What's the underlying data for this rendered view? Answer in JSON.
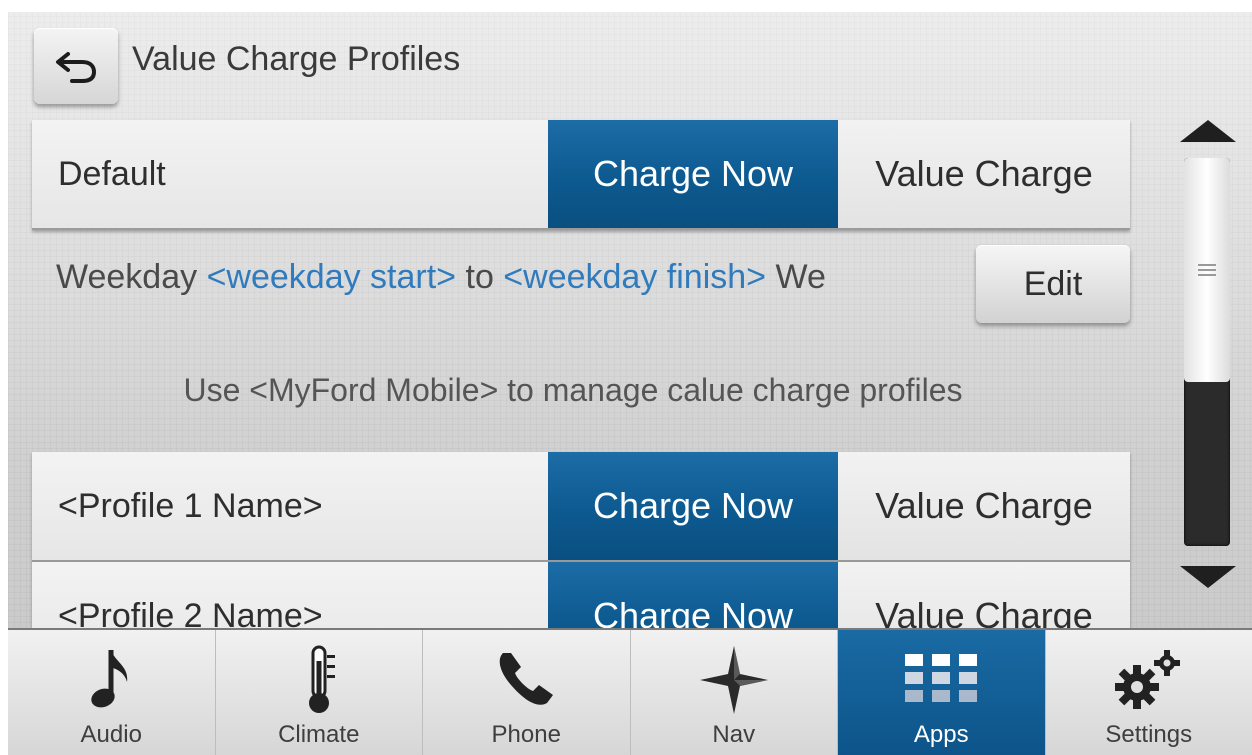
{
  "header": {
    "title": "Value Charge Profiles",
    "back_icon": "back-arrow-icon"
  },
  "rows": [
    {
      "name": "Default",
      "charge_now": "Charge Now",
      "value_charge": "Value Charge",
      "selected": "Charge Now"
    },
    {
      "name": "<Profile 1 Name>",
      "charge_now": "Charge Now",
      "value_charge": "Value Charge",
      "selected": "Charge Now"
    },
    {
      "name": "<Profile 2 Name>",
      "charge_now": "Charge Now",
      "value_charge": "Value Charge",
      "selected": "Charge Now"
    }
  ],
  "schedule": {
    "prefix": "Weekday ",
    "start": "<weekday start>",
    "mid": " to ",
    "finish": "<weekday finish>",
    "suffix": " We"
  },
  "edit_label": "Edit",
  "manage_note": "Use <MyFord Mobile> to manage calue charge profiles",
  "nav": {
    "active": "Apps",
    "tabs": [
      {
        "label": "Audio",
        "icon": "music-note-icon"
      },
      {
        "label": "Climate",
        "icon": "thermometer-icon"
      },
      {
        "label": "Phone",
        "icon": "phone-handset-icon"
      },
      {
        "label": "Nav",
        "icon": "compass-star-icon"
      },
      {
        "label": "Apps",
        "icon": "apps-grid-icon"
      },
      {
        "label": "Settings",
        "icon": "gears-icon"
      }
    ]
  },
  "colors": {
    "accent_blue": "#0d5a90",
    "link_blue": "#2f7bbd"
  }
}
